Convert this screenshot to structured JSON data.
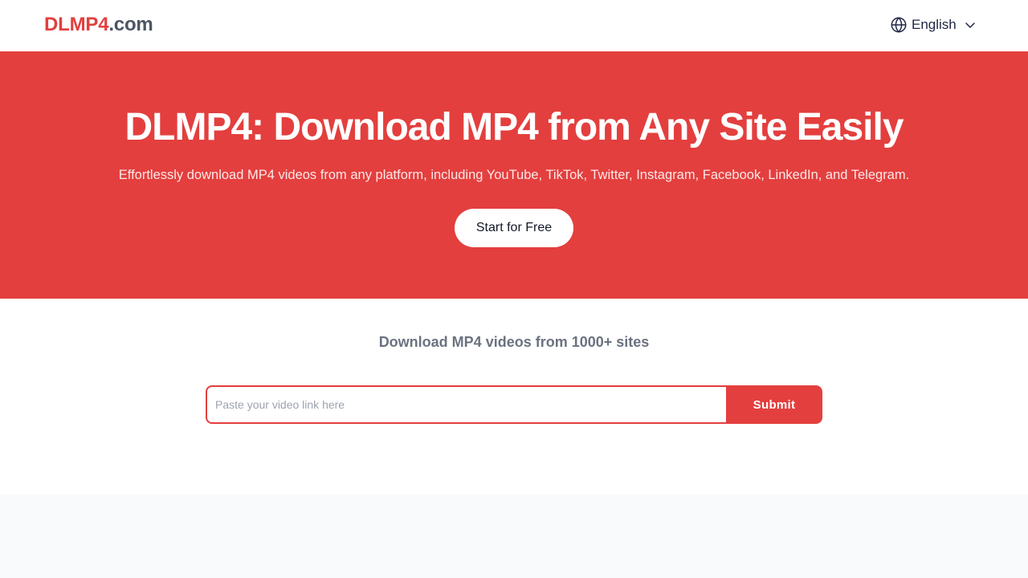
{
  "header": {
    "logo_brand": "DLMP4",
    "logo_tld": ".com",
    "language_label": "English",
    "language_icon": "globe-icon",
    "dropdown_icon": "chevron-down-icon"
  },
  "hero": {
    "title": "DLMP4: Download MP4 from Any Site Easily",
    "subtitle": "Effortlessly download MP4 videos from any platform, including YouTube, TikTok, Twitter, Instagram, Facebook, LinkedIn, and Telegram.",
    "cta_label": "Start for Free"
  },
  "download": {
    "heading": "Download MP4 videos from 1000+ sites",
    "input_value": "",
    "input_placeholder": "Paste your video link here",
    "submit_label": "Submit"
  },
  "colors": {
    "accent": "#e33f3e",
    "header_bg": "#ffffff",
    "page_bg": "#f8fafc",
    "logo_tld": "#4b5563",
    "muted_text": "#6b7280"
  }
}
